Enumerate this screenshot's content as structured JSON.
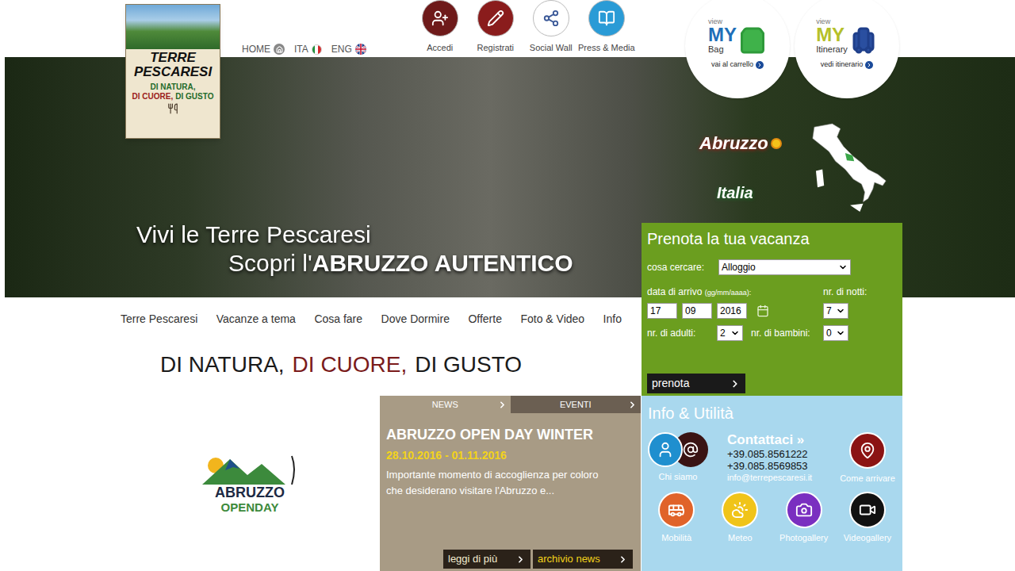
{
  "logo": {
    "title": "TERRE PESCARESI",
    "motto": [
      {
        "text": "DI NATURA,",
        "color": "#1f6b2a"
      },
      {
        "text": "DI CUORE,",
        "color": "#9b1b1b"
      },
      {
        "text": "DI GUSTO",
        "color": "#1f6b2a"
      }
    ]
  },
  "lang_links": [
    "HOME",
    "ITA",
    "ENG"
  ],
  "top_actions": [
    {
      "label": "Accedi",
      "color": "#6e1a1a"
    },
    {
      "label": "Registrati",
      "color": "#8a1c1c"
    },
    {
      "label": "Social Wall",
      "color": "#ffffff"
    },
    {
      "label": "Press & Media",
      "color": "#2a9bd6"
    }
  ],
  "cart_badges": [
    {
      "prefix": "view",
      "my": "MY",
      "name": "Bag",
      "link": "vai al carrello",
      "color": "#1f6fb8"
    },
    {
      "prefix": "view",
      "my": "MY",
      "name": "Itinerary",
      "link": "vedi itinerario",
      "color": "#b5c02a"
    }
  ],
  "hero": {
    "line1": "Vivi le Terre Pescaresi",
    "line2_prefix": "Scopri l'",
    "line2_bold": "ABRUZZO AUTENTICO",
    "brands": [
      "Abruzzo",
      "Italia"
    ]
  },
  "nav": [
    "Terre Pescaresi",
    "Vacanze a tema",
    "Cosa fare",
    "Dove Dormire",
    "Offerte",
    "Foto & Video",
    "Info"
  ],
  "tagline": [
    {
      "text": "DI NATURA,",
      "color": "#1a1a1a"
    },
    {
      "text": "DI CUORE,",
      "color": "#7a1b1b"
    },
    {
      "text": "DI GUSTO",
      "color": "#1a1a1a"
    }
  ],
  "open_day": {
    "line1": "ABRUZZO",
    "line2": "OPENDAY"
  },
  "news": {
    "tabs": [
      {
        "label": "NEWS",
        "selected": true
      },
      {
        "label": "EVENTI",
        "selected": false
      }
    ],
    "title": "ABRUZZO OPEN DAY WINTER",
    "date": "28.10.2016 - 01.11.2016",
    "excerpt": "Importante momento di accoglienza per coloro che desiderano visitare l'Abruzzo e...",
    "buttons": [
      "leggi di più",
      "archivio news"
    ]
  },
  "booking": {
    "title": "Prenota la tua vacanza",
    "search_label": "cosa cercare:",
    "search_value": "Alloggio",
    "arrival_label": "data di arrivo",
    "arrival_hint": "(gg/mm/aaaa):",
    "day": "17",
    "month": "09",
    "year": "2016",
    "nights_label": "nr. di notti:",
    "nights": "7",
    "adults_label": "nr. di adulti:",
    "adults": "2",
    "children_label": "nr. di bambini:",
    "children": "0",
    "button": "prenota"
  },
  "info": {
    "title": "Info & Utilità",
    "contact_title": "Contattaci »",
    "phones": [
      "+39.085.8561222",
      "+39.085.8569853"
    ],
    "email": "info@terrepescaresi.it",
    "tiles": [
      {
        "label": "Chi siamo",
        "color": "#1f8fcf"
      },
      {
        "label": "Come arrivare",
        "color": "#8b1414"
      },
      {
        "label": "Mobilità",
        "color": "#e0632a"
      },
      {
        "label": "Meteo",
        "color": "#f0c419"
      },
      {
        "label": "Photogallery",
        "color": "#7a2fc0"
      },
      {
        "label": "Videogallery",
        "color": "#111111"
      }
    ]
  }
}
